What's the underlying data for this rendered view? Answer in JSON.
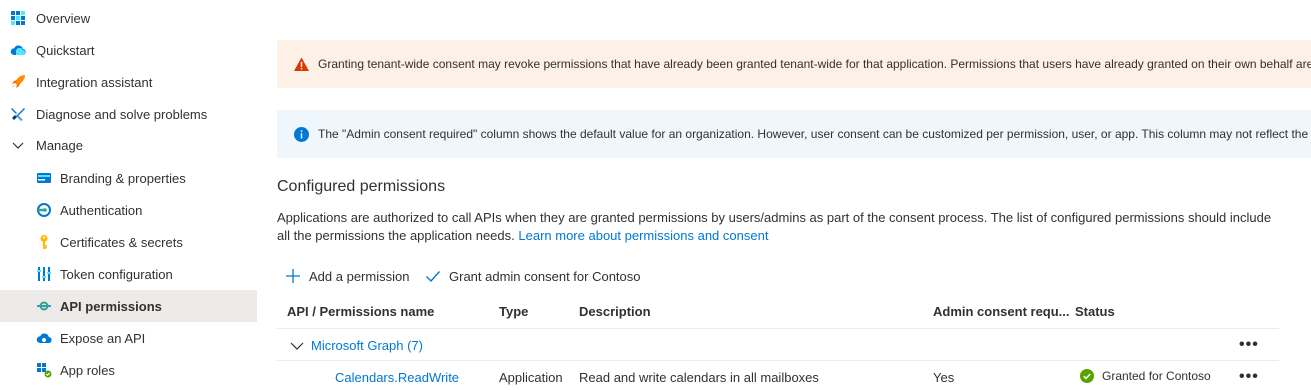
{
  "sidebar": {
    "items": [
      {
        "label": "Overview",
        "icon": "overview-grid-icon"
      },
      {
        "label": "Quickstart",
        "icon": "cloud-icon"
      },
      {
        "label": "Integration assistant",
        "icon": "rocket-icon"
      },
      {
        "label": "Diagnose and solve problems",
        "icon": "wrench-icon"
      },
      {
        "label": "Manage",
        "icon": "chevron-down-icon"
      },
      {
        "label": "Branding & properties",
        "icon": "branding-card-icon"
      },
      {
        "label": "Authentication",
        "icon": "authentication-icon"
      },
      {
        "label": "Certificates & secrets",
        "icon": "key-icon"
      },
      {
        "label": "Token configuration",
        "icon": "token-bars-icon"
      },
      {
        "label": "API permissions",
        "icon": "api-permissions-icon"
      },
      {
        "label": "Expose an API",
        "icon": "cloud-api-icon"
      },
      {
        "label": "App roles",
        "icon": "app-roles-icon"
      }
    ],
    "selected": "API permissions"
  },
  "banners": {
    "warning": "Granting tenant-wide consent may revoke permissions that have already been granted tenant-wide for that application. Permissions that users have already granted on their own behalf are",
    "info": "The \"Admin consent required\" column shows the default value for an organization. However, user consent can be customized per permission, user, or app. This column may not reflect the va"
  },
  "section": {
    "title": "Configured permissions",
    "description": "Applications are authorized to call APIs when they are granted permissions by users/admins as part of the consent process. The list of configured permissions should include all the permissions the application needs.",
    "learn_more": "Learn more about permissions and consent"
  },
  "toolbar": {
    "add_permission": "Add a permission",
    "grant_consent": "Grant admin consent for Contoso"
  },
  "table": {
    "columns": [
      "API / Permissions name",
      "Type",
      "Description",
      "Admin consent requ...",
      "Status"
    ],
    "group": {
      "label": "Microsoft Graph (7)",
      "more": "•••"
    },
    "rows": [
      {
        "name": "Calendars.ReadWrite",
        "type": "Application",
        "description": "Read and write calendars in all mailboxes",
        "admin_consent": "Yes",
        "status": "Granted for Contoso",
        "more": "•••"
      }
    ]
  },
  "colors": {
    "accent": "#0078d4",
    "warning_bg": "#fdf0e6",
    "info_bg": "#eff6fc",
    "selected_bg": "#edebe9",
    "success": "#57a300"
  }
}
